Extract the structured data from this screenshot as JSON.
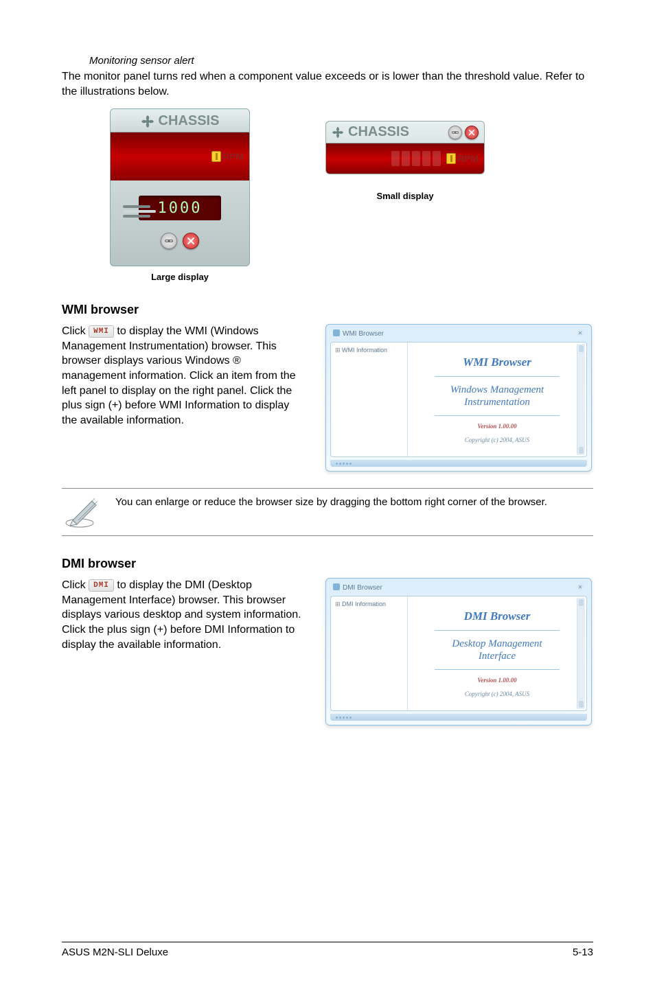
{
  "sensor_alert": {
    "heading_italic": "Monitoring sensor alert",
    "body": "The monitor panel turns red when a component value exceeds or is lower than the threshold value. Refer to the illustrations below.",
    "large": {
      "title": "CHASSIS",
      "rpm_label": "RPM",
      "digital": "1000",
      "caption": "Large display"
    },
    "small": {
      "title": "CHASSIS",
      "rpm_label": "RPM",
      "caption": "Small display"
    }
  },
  "wmi": {
    "title": "WMI browser",
    "pre_text": "Click ",
    "btn_label": "WMI",
    "post_text": " to display the WMI (Windows Management Instrumentation) browser. This browser displays various Windows ® management information. Click an item from the left panel to display on the right panel. Click the plus sign (+) before WMI Information to display the available information.",
    "browser": {
      "titlebar_left": "WMI Browser",
      "tree_root": "WMI Information",
      "content_title": "WMI  Browser",
      "content_sub1": "Windows Management",
      "content_sub2": "Instrumentation",
      "version": "Version 1.00.00",
      "copyright": "Copyright (c) 2004,  ASUS"
    },
    "note": "You can enlarge or reduce the browser size by dragging the bottom right corner of the browser."
  },
  "dmi": {
    "title": "DMI browser",
    "pre_text": "Click ",
    "btn_label": "DMI",
    "post_text": " to display the DMI (Desktop Management Interface) browser. This browser displays various desktop and system information. Click the plus sign (+) before DMI Information to display the available information.",
    "browser": {
      "titlebar_left": "DMI Browser",
      "tree_root": "DMI Information",
      "content_title": "DMI  Browser",
      "content_sub1": "Desktop Management",
      "content_sub2": "Interface",
      "version": "Version 1.00.00",
      "copyright": "Copyright (c) 2004,  ASUS"
    }
  },
  "footer": {
    "left": "ASUS M2N-SLI Deluxe",
    "right": "5-13"
  }
}
